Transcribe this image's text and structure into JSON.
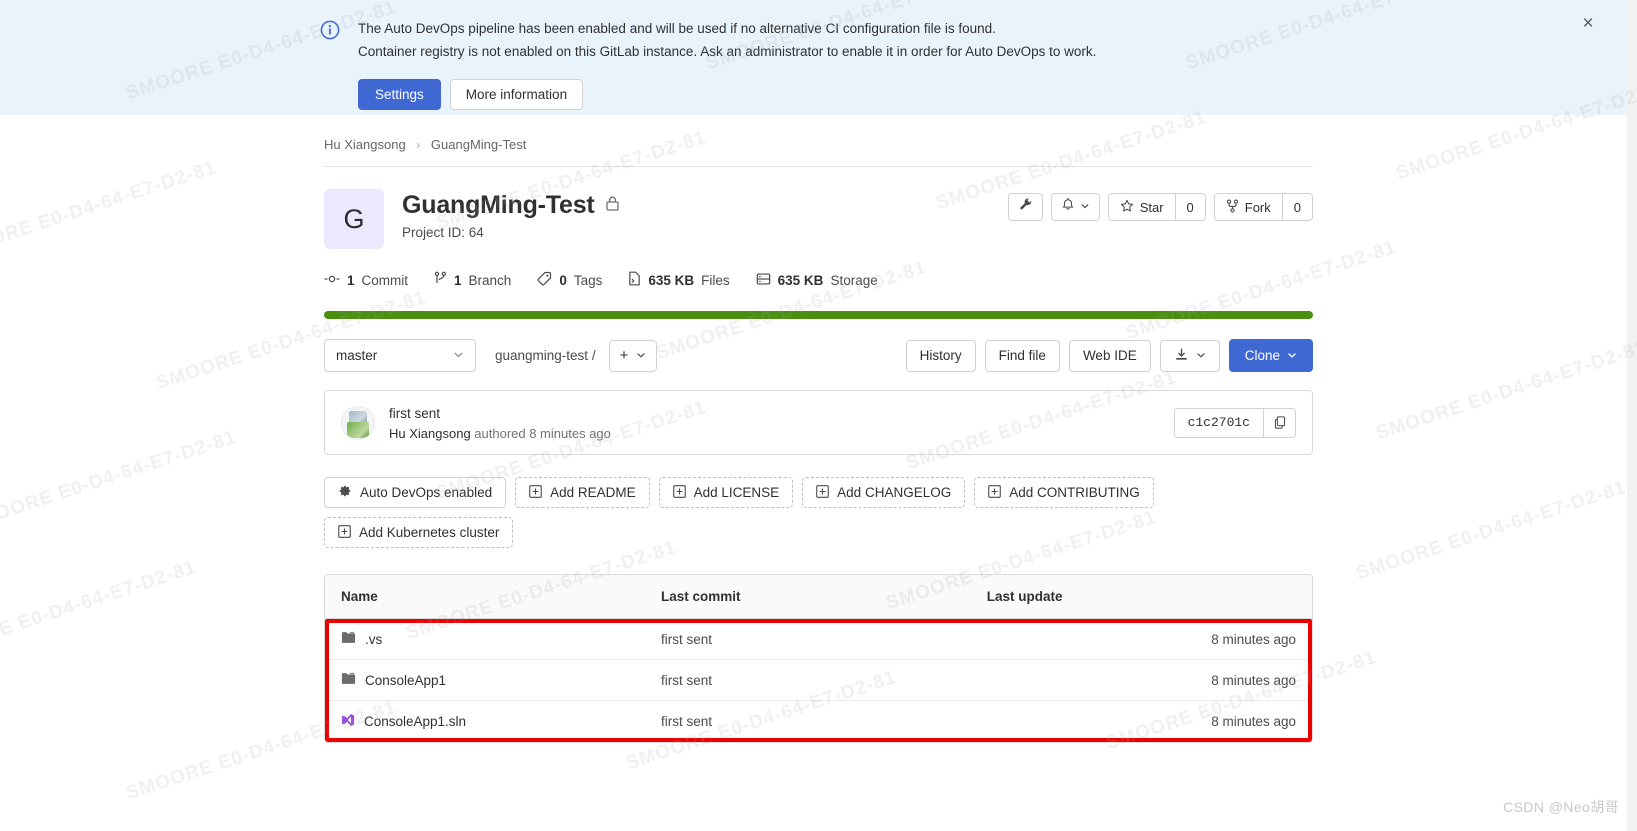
{
  "alert": {
    "icon": "info-circle-icon",
    "line1": "The Auto DevOps pipeline has been enabled and will be used if no alternative CI configuration file is found.",
    "line2": "Container registry is not enabled on this GitLab instance. Ask an administrator to enable it in order for Auto DevOps to work.",
    "settings_label": "Settings",
    "more_info_label": "More information",
    "close_label": "×",
    "bg_color": "#e9f3fc",
    "primary_color": "#3f68d2"
  },
  "breadcrumb": {
    "group": "Hu Xiangsong",
    "separator": "›",
    "project": "GuangMing-Test"
  },
  "project": {
    "avatar_letter": "G",
    "name": "GuangMing-Test",
    "visibility_icon": "lock-icon",
    "project_id_label": "Project ID: 64",
    "actions": {
      "settings_icon": "wrench-icon",
      "notifications_icon": "bell-icon",
      "notifications_caret": "chevron-down-icon",
      "star_label": "Star",
      "star_count": "0",
      "star_icon": "star-icon",
      "fork_label": "Fork",
      "fork_count": "0",
      "fork_icon": "fork-icon"
    },
    "stats": [
      {
        "icon": "commit-icon",
        "value": "1",
        "label": "Commit"
      },
      {
        "icon": "branch-icon",
        "value": "1",
        "label": "Branch"
      },
      {
        "icon": "tag-icon",
        "value": "0",
        "label": "Tags"
      },
      {
        "icon": "file-icon",
        "value": "635 KB",
        "label": "Files"
      },
      {
        "icon": "storage-icon",
        "value": "635 KB",
        "label": "Storage"
      }
    ],
    "language_bar_color": "#4a8f10"
  },
  "toolbar": {
    "branch": "master",
    "branch_caret": "chevron-down-icon",
    "path_root": "guangming-test",
    "path_separator": "/",
    "plus_label": "+",
    "plus_caret": "chevron-down-icon",
    "history_label": "History",
    "find_file_label": "Find file",
    "web_ide_label": "Web IDE",
    "download_icon": "download-icon",
    "download_caret": "chevron-down-icon",
    "clone_label": "Clone",
    "clone_caret": "chevron-down-icon"
  },
  "commit": {
    "title": "first sent",
    "author": "Hu Xiangsong",
    "meta": " authored 8 minutes ago",
    "sha": "c1c2701c",
    "copy_icon": "copy-icon",
    "avatar_icon": "user-avatar"
  },
  "add_buttons": [
    {
      "icon": "gear-icon",
      "label": "Auto DevOps enabled",
      "solid": true
    },
    {
      "icon": "plus-square-icon",
      "label": "Add README",
      "solid": false
    },
    {
      "icon": "plus-square-icon",
      "label": "Add LICENSE",
      "solid": false
    },
    {
      "icon": "plus-square-icon",
      "label": "Add CHANGELOG",
      "solid": false
    },
    {
      "icon": "plus-square-icon",
      "label": "Add CONTRIBUTING",
      "solid": false
    },
    {
      "icon": "plus-square-icon",
      "label": "Add Kubernetes cluster",
      "solid": false
    }
  ],
  "file_table": {
    "headers": {
      "name": "Name",
      "last_commit": "Last commit",
      "last_update": "Last update"
    },
    "rows": [
      {
        "icon": "folder-icon",
        "name": ".vs",
        "last_commit": "first sent",
        "last_update": "8 minutes ago"
      },
      {
        "icon": "folder-icon",
        "name": "ConsoleApp1",
        "last_commit": "first sent",
        "last_update": "8 minutes ago"
      },
      {
        "icon": "visual-studio-solution-icon",
        "name": "ConsoleApp1.sln",
        "last_commit": "first sent",
        "last_update": "8 minutes ago"
      }
    ],
    "highlight_color": "#ee0000"
  },
  "watermarks": {
    "tiled_text": "SMOORE E0-D4-64-E7-D2-81",
    "csdn": "CSDN @Neo胡哥"
  }
}
